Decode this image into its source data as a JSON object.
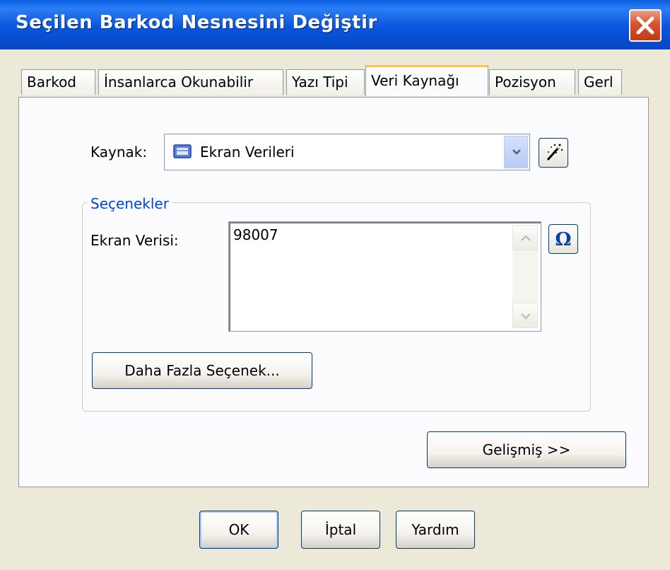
{
  "window": {
    "title": "Seçilen Barkod Nesnesini Değiştir",
    "close_icon": "close-icon"
  },
  "tabs": [
    {
      "label": "Barkod",
      "active": false
    },
    {
      "label": "İnsanlarca Okunabilir",
      "active": false
    },
    {
      "label": "Yazı Tipi",
      "active": false
    },
    {
      "label": "Veri Kaynağı",
      "active": true
    },
    {
      "label": "Pozisyon",
      "active": false
    },
    {
      "label": "Gerl",
      "active": false
    }
  ],
  "source": {
    "label": "Kaynak:",
    "selected": "Ekran Verileri",
    "item_icon": "screen-data-icon",
    "wizard_icon": "magic-wand-icon"
  },
  "options": {
    "legend": "Seçenekler",
    "screen_data_label": "Ekran Verisi:",
    "screen_data_value": "98007",
    "symbol_icon": "omega-icon",
    "more_options_label": "Daha Fazla Seçenek..."
  },
  "advanced_label": "Gelişmiş >>",
  "footer": {
    "ok_label": "OK",
    "cancel_label": "İptal",
    "help_label": "Yardım"
  },
  "colors": {
    "titlebar": "#0855dd",
    "accent": "#0046d5",
    "active_tab": "#ffc83c",
    "close": "#d8522e"
  }
}
